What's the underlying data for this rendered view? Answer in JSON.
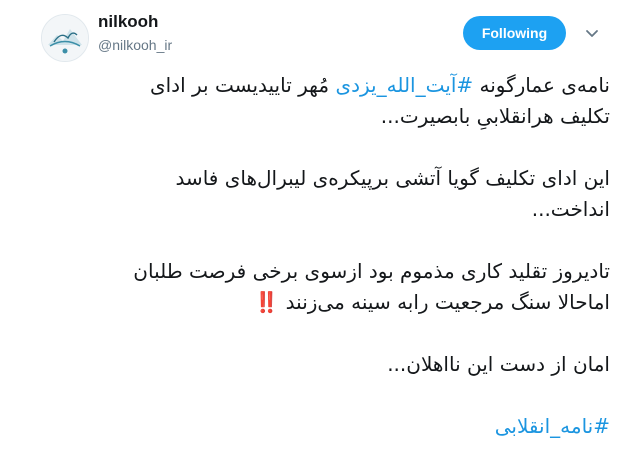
{
  "user": {
    "name": "nilkooh",
    "handle": "@nilkooh_ir",
    "follow_label": "Following"
  },
  "colors": {
    "accent": "#1da1f2",
    "hashtag": "#1b95e0",
    "text": "#14171a",
    "muted": "#657786"
  },
  "icons": {
    "caret": "chevron-down-icon",
    "avatar": "mountain-logo",
    "emoji": "double-exclamation-emoji"
  },
  "tweet": {
    "p1_part1": "نامه‌ی عمارگونه ",
    "p1_hashtag": "#آیت_الله_یزدی",
    "p1_part2": " مُهر تاییدیست بر ادای",
    "p1_line2": "تکلیف هرانقلابیِ بابصیرت...",
    "p2_line1": "این ادای تکلیف گویا آتشی برپیکره‌ی لیبرال‌های فاسد",
    "p2_line2": "انداخت...",
    "p3_line1": "تادیروز تقلید کاری مذموم بود ازسوی برخی فرصت طلبان",
    "p3_line2": "اماحالا سنگ مرجعیت رابه سینه می‌زنند",
    "p3_emoji": "‼️",
    "p4_line1": "امان از دست این نااهلان...",
    "hashtag_final": "#نامه_انقلابی"
  }
}
